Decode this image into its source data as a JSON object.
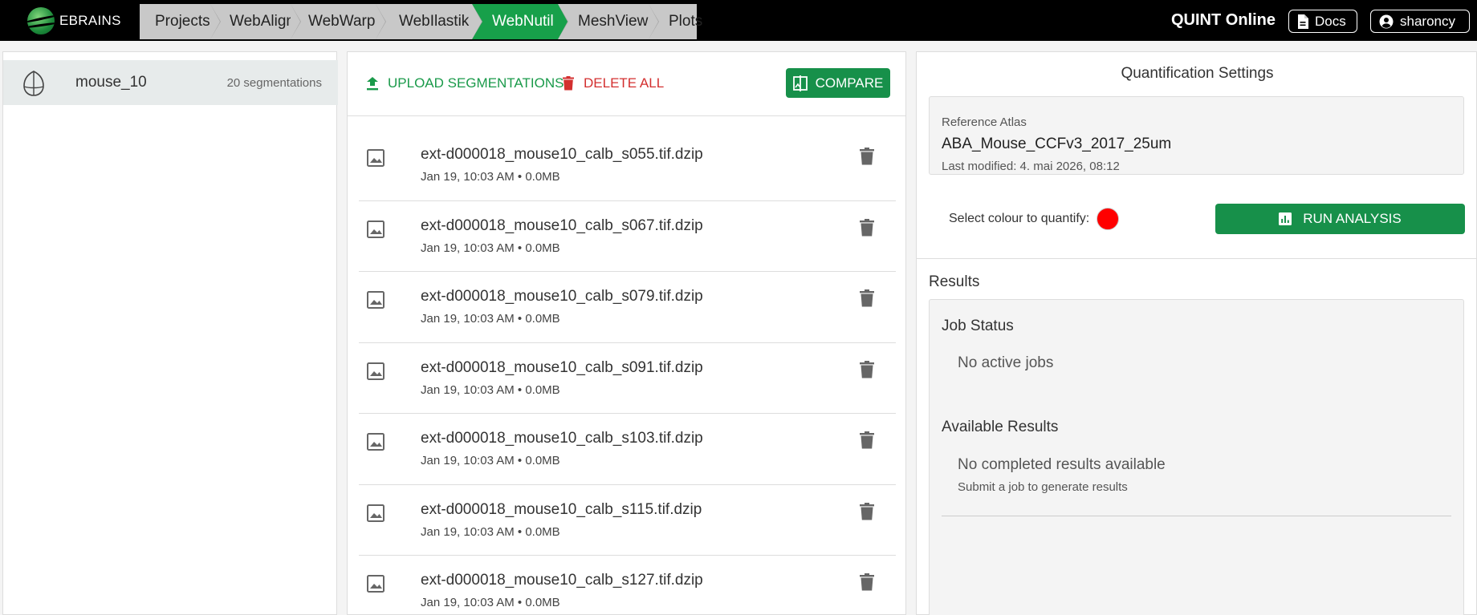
{
  "header": {
    "logo_text": "EBRAINS",
    "breadcrumbs": [
      "Projects",
      "WebAlign",
      "WebWarp",
      "WebIlastik",
      "WebNutil",
      "MeshView",
      "Plots"
    ],
    "active_crumb": "WebNutil",
    "app_title": "QUINT Online",
    "docs_label": "Docs",
    "user_label": "sharoncy"
  },
  "sidebar": {
    "item_name": "mouse_10",
    "item_count": "20 segmentations"
  },
  "toolbar": {
    "upload_label": "UPLOAD SEGMENTATIONS",
    "delete_label": "DELETE ALL",
    "compare_label": "COMPARE"
  },
  "files": [
    {
      "name": "ext-d000018_mouse10_calb_s055.tif.dzip",
      "meta": "Jan 19, 10:03 AM • 0.0MB"
    },
    {
      "name": "ext-d000018_mouse10_calb_s067.tif.dzip",
      "meta": "Jan 19, 10:03 AM • 0.0MB"
    },
    {
      "name": "ext-d000018_mouse10_calb_s079.tif.dzip",
      "meta": "Jan 19, 10:03 AM • 0.0MB"
    },
    {
      "name": "ext-d000018_mouse10_calb_s091.tif.dzip",
      "meta": "Jan 19, 10:03 AM • 0.0MB"
    },
    {
      "name": "ext-d000018_mouse10_calb_s103.tif.dzip",
      "meta": "Jan 19, 10:03 AM • 0.0MB"
    },
    {
      "name": "ext-d000018_mouse10_calb_s115.tif.dzip",
      "meta": "Jan 19, 10:03 AM • 0.0MB"
    },
    {
      "name": "ext-d000018_mouse10_calb_s127.tif.dzip",
      "meta": "Jan 19, 10:03 AM • 0.0MB"
    }
  ],
  "settings": {
    "title": "Quantification Settings",
    "atlas_label": "Reference Atlas",
    "atlas_value": "ABA_Mouse_CCFv3_2017_25um",
    "last_modified": "Last modified: 4. mai 2026, 08:12",
    "colour_label": "Select colour to quantify:",
    "colour_value": "#ff0000",
    "run_label": "RUN ANALYSIS"
  },
  "results": {
    "title": "Results",
    "job_status_title": "Job Status",
    "job_status_text": "No active jobs",
    "available_title": "Available Results",
    "available_text": "No completed results available",
    "available_hint": "Submit a job to generate results"
  },
  "colors": {
    "brand_green": "#17a04a",
    "button_green": "#17904a",
    "danger_red": "#d32f2f"
  }
}
